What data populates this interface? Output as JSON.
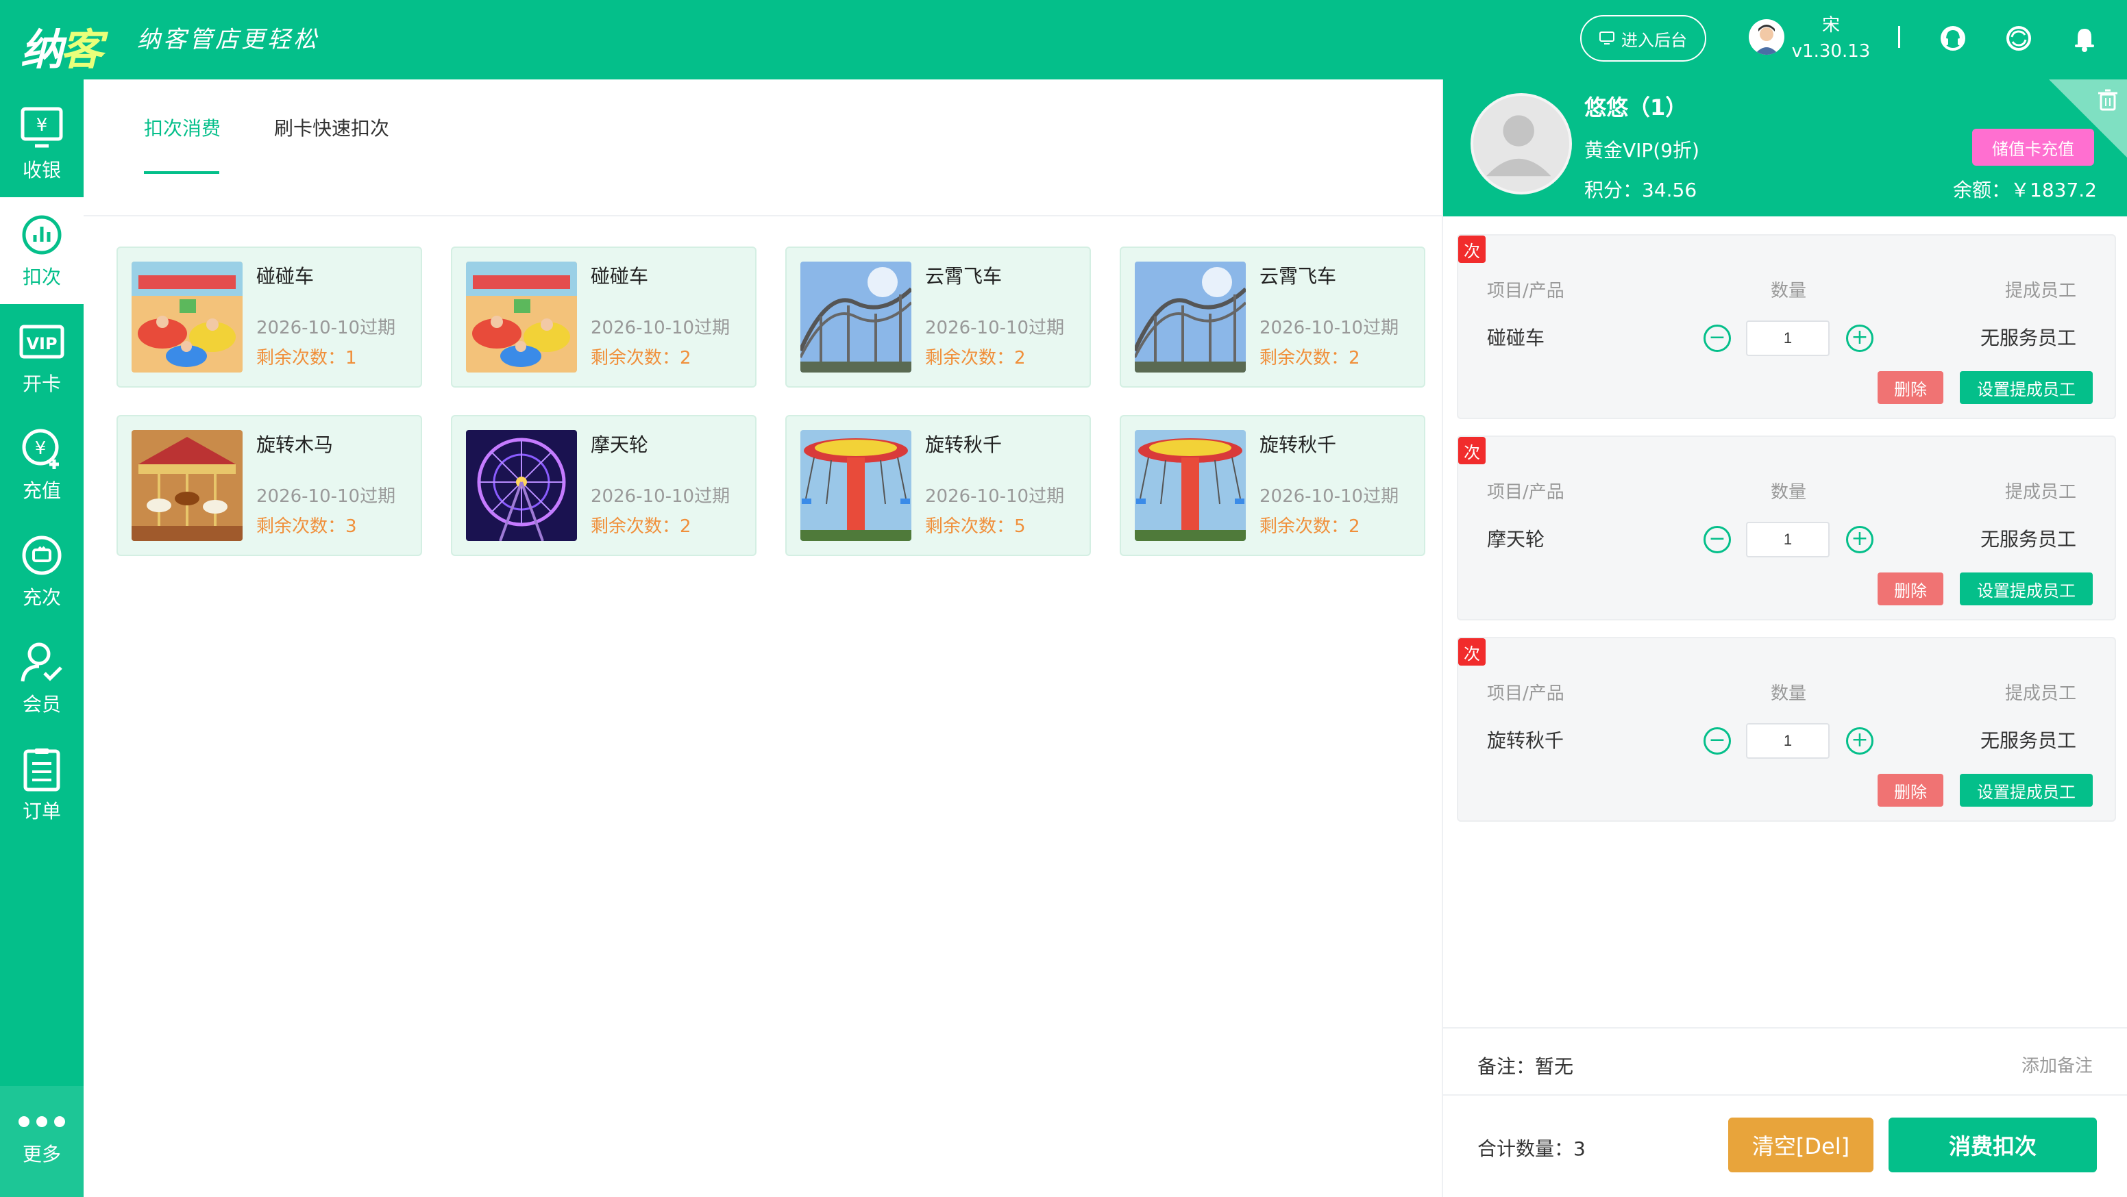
{
  "header": {
    "logo": "纳客",
    "slogan": "纳客管店更轻松",
    "admin_button": "进入后台",
    "user_name": "宋",
    "version": "v1.30.13"
  },
  "sidebar": {
    "items": [
      {
        "label": "收银",
        "icon": "cash-register-icon"
      },
      {
        "label": "扣次",
        "icon": "chart-circle-icon"
      },
      {
        "label": "开卡",
        "icon": "vip-card-icon"
      },
      {
        "label": "充值",
        "icon": "yuan-plus-icon"
      },
      {
        "label": "充次",
        "icon": "refill-times-icon"
      },
      {
        "label": "会员",
        "icon": "member-icon"
      },
      {
        "label": "订单",
        "icon": "order-list-icon"
      }
    ],
    "more_label": "更多"
  },
  "tabs": [
    "扣次消费",
    "刷卡快速扣次"
  ],
  "cards": [
    {
      "name": "碰碰车",
      "expire": "2026-10-10过期",
      "remain": "剩余次数：1",
      "image": "bumper-cars"
    },
    {
      "name": "碰碰车",
      "expire": "2026-10-10过期",
      "remain": "剩余次数：2",
      "image": "bumper-cars"
    },
    {
      "name": "云霄飞车",
      "expire": "2026-10-10过期",
      "remain": "剩余次数：2",
      "image": "roller-coaster"
    },
    {
      "name": "云霄飞车",
      "expire": "2026-10-10过期",
      "remain": "剩余次数：2",
      "image": "roller-coaster"
    },
    {
      "name": "旋转木马",
      "expire": "2026-10-10过期",
      "remain": "剩余次数：3",
      "image": "carousel"
    },
    {
      "name": "摩天轮",
      "expire": "2026-10-10过期",
      "remain": "剩余次数：2",
      "image": "ferris-wheel"
    },
    {
      "name": "旋转秋千",
      "expire": "2026-10-10过期",
      "remain": "剩余次数：5",
      "image": "swing-ride"
    },
    {
      "name": "旋转秋千",
      "expire": "2026-10-10过期",
      "remain": "剩余次数：2",
      "image": "swing-ride"
    }
  ],
  "member": {
    "name": "悠悠（1）",
    "level": "黄金VIP(9折)",
    "points": "积分：34.56",
    "balance": "余额：￥1837.2",
    "recharge_button": "储值卡充值"
  },
  "order": {
    "badge": "次",
    "headers": {
      "item": "项目/产品",
      "qty": "数量",
      "staff": "提成员工"
    },
    "items": [
      {
        "name": "碰碰车",
        "qty": "1",
        "staff": "无服务员工"
      },
      {
        "name": "摩天轮",
        "qty": "1",
        "staff": "无服务员工"
      },
      {
        "name": "旋转秋千",
        "qty": "1",
        "staff": "无服务员工"
      }
    ],
    "delete_label": "删除",
    "set_staff_label": "设置提成员工"
  },
  "note": {
    "label": "备注：暂无",
    "add": "添加备注"
  },
  "footer": {
    "total": "合计数量：3",
    "clear": "清空[Del]",
    "consume": "消费扣次"
  },
  "colors": {
    "primary": "#04bf8a",
    "orange": "#f08f3a",
    "danger": "#f07373",
    "recharge": "#ff6fd0",
    "clear": "#e8a43b"
  }
}
